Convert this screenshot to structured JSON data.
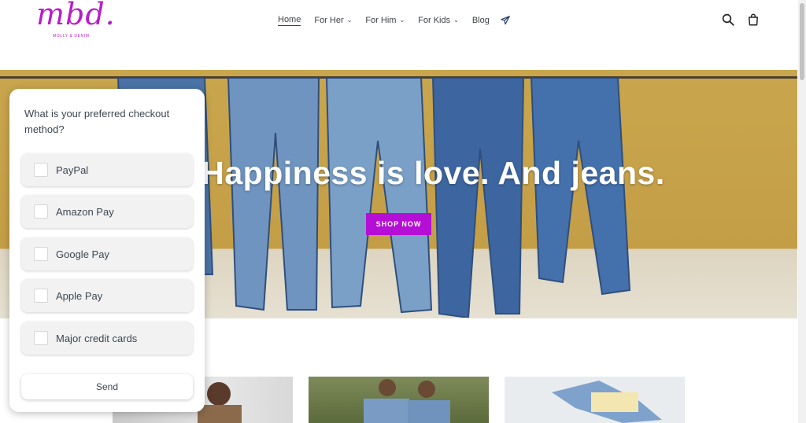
{
  "header": {
    "logo_text": "mbd.",
    "logo_subtitle": "MOLLY & DENIM",
    "nav": [
      {
        "label": "Home",
        "has_dropdown": false,
        "active": true
      },
      {
        "label": "For Her",
        "has_dropdown": true
      },
      {
        "label": "For Him",
        "has_dropdown": true
      },
      {
        "label": "For Kids",
        "has_dropdown": true
      },
      {
        "label": "Blog",
        "has_dropdown": false
      }
    ],
    "nav_extra_icon": "airplane-icon",
    "right_icons": [
      "search-icon",
      "cart-icon"
    ]
  },
  "hero": {
    "title": "Happiness is love. And jeans.",
    "button_label": "SHOP NOW"
  },
  "survey": {
    "question": "What is your preferred checkout method?",
    "options": [
      {
        "label": "PayPal",
        "checked": false
      },
      {
        "label": "Amazon Pay",
        "checked": false
      },
      {
        "label": "Google Pay",
        "checked": false
      },
      {
        "label": "Apple Pay",
        "checked": false
      },
      {
        "label": "Major credit cards",
        "checked": false
      }
    ],
    "send_label": "Send"
  },
  "colors": {
    "brand": "#b91cc9",
    "button": "#b50fd6",
    "text": "#3d4246"
  }
}
